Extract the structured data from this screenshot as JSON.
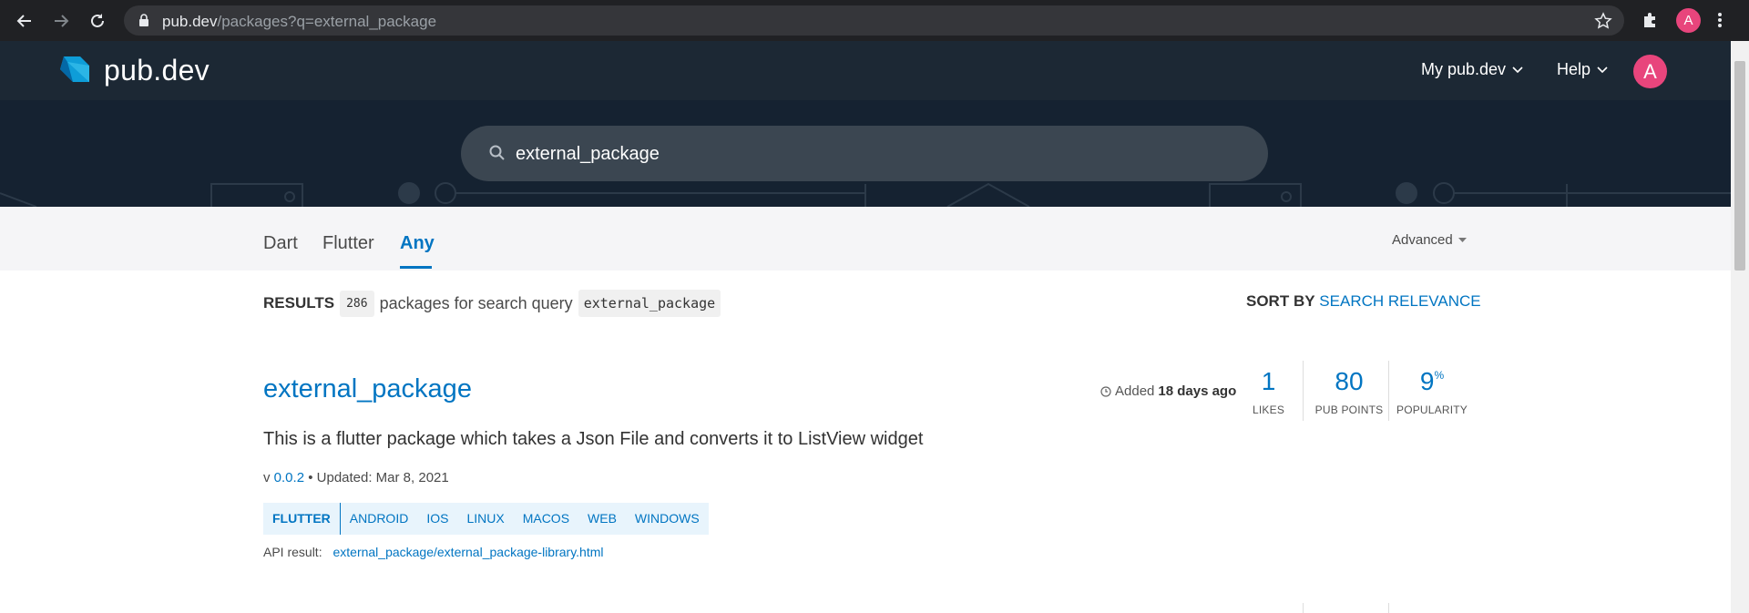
{
  "browser": {
    "url_host": "pub.dev",
    "url_path": "/packages?q=external_package",
    "profile_initial": "A"
  },
  "header": {
    "logo_text": "pub.dev",
    "nav": [
      {
        "label": "My pub.dev"
      },
      {
        "label": "Help"
      }
    ],
    "user_initial": "A"
  },
  "search": {
    "query": "external_package"
  },
  "tabs": [
    {
      "label": "Dart"
    },
    {
      "label": "Flutter"
    },
    {
      "label": "Any"
    }
  ],
  "advanced_label": "Advanced",
  "results": {
    "label": "RESULTS",
    "count": "286",
    "text": "packages for search query",
    "query": "external_package"
  },
  "sort": {
    "label": "SORT BY",
    "value": "SEARCH RELEVANCE"
  },
  "package": {
    "name": "external_package",
    "added_prefix": "Added",
    "added_time": "18 days ago",
    "likes": "1",
    "likes_label": "LIKES",
    "points": "80",
    "points_label": "PUB POINTS",
    "popularity": "9",
    "popularity_unit": "%",
    "popularity_label": "POPULARITY",
    "description": "This is a flutter package which takes a Json File and converts it to ListView widget",
    "version_prefix": "v",
    "version": "0.0.2",
    "updated": "• Updated: Mar 8, 2021",
    "tags": [
      "FLUTTER",
      "ANDROID",
      "IOS",
      "LINUX",
      "MACOS",
      "WEB",
      "WINDOWS"
    ],
    "api_label": "API result:",
    "api_link": "external_package/external_package-library.html"
  },
  "colors": {
    "accent": "#0175c2",
    "header_bg": "#1c2834",
    "banner_bg": "#152231",
    "avatar": "#e8457c"
  }
}
